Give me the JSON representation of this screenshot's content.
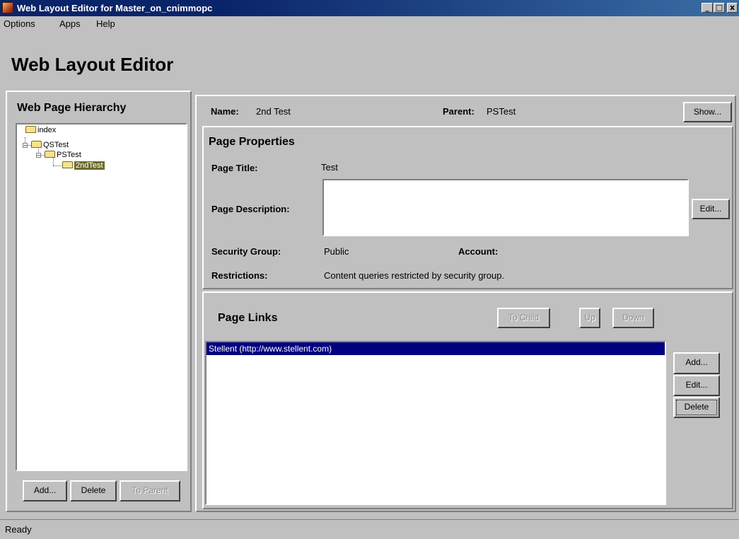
{
  "window": {
    "title": "Web Layout Editor for Master_on_cnimmopc",
    "controls": {
      "minimize": "_",
      "maximize": "□",
      "close": "x"
    }
  },
  "menu": [
    "Options",
    "Apps",
    "Help"
  ],
  "app_heading": "Web Layout Editor",
  "hierarchy": {
    "title": "Web Page Hierarchy",
    "nodes": [
      "index",
      "QSTest",
      "PSTest",
      "2ndTest"
    ],
    "selected": "2ndTest",
    "buttons": {
      "add": "Add...",
      "delete": "Delete",
      "to_parent": "To Parent"
    }
  },
  "header": {
    "name_label": "Name:",
    "name_value": "2nd Test",
    "parent_label": "Parent:",
    "parent_value": "PSTest",
    "show_button": "Show..."
  },
  "page_properties": {
    "title": "Page Properties",
    "page_title_label": "Page Title:",
    "page_title_value": "Test",
    "description_label": "Page Description:",
    "description_value": "",
    "edit_button": "Edit...",
    "security_group_label": "Security Group:",
    "security_group_value": "Public",
    "account_label": "Account:",
    "account_value": "",
    "restrictions_label": "Restrictions:",
    "restrictions_value": "Content queries restricted by security group."
  },
  "page_links": {
    "title": "Page Links",
    "buttons": {
      "to_child": "To Child",
      "up": "Up",
      "down": "Down",
      "add": "Add...",
      "edit": "Edit...",
      "delete": "Delete"
    },
    "items": [
      "Stellent (http://www.stellent.com)"
    ],
    "selected_index": 0
  },
  "status": "Ready",
  "colors": {
    "titlebar": "#0a246a",
    "selection": "#000080",
    "tree_selection": "#6b6b2e",
    "face": "#c0c0c0"
  }
}
